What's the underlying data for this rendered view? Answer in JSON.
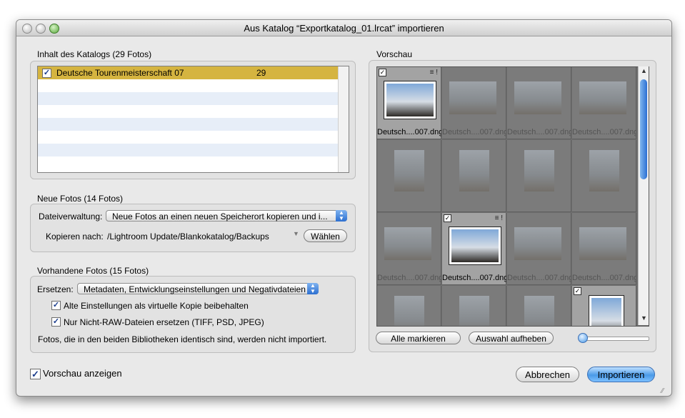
{
  "window": {
    "title": "Aus Katalog “Exportkatalog_01.lrcat” importieren"
  },
  "catalog": {
    "label": "Inhalt des Katalogs (29 Fotos)",
    "rows": [
      {
        "name": "Deutsche Tourenmeisterschaft 07",
        "count": "29",
        "checked": true
      }
    ]
  },
  "new_photos": {
    "label": "Neue Fotos (14 Fotos)",
    "file_handling_label": "Dateiverwaltung:",
    "file_handling_value": "Neue Fotos an einen neuen Speicherort kopieren und i...",
    "copy_to_label": "Kopieren nach:",
    "copy_to_path": "/Lightroom Update/Blankokatalog/Backups",
    "choose_button": "Wählen"
  },
  "existing_photos": {
    "label": "Vorhandene Fotos (15 Fotos)",
    "replace_label": "Ersetzen:",
    "replace_value": "Metadaten, Entwicklungseinstellungen und Negativdateien",
    "keep_old_label": "Alte Einstellungen als virtuelle Kopie beibehalten",
    "non_raw_label": "Nur Nicht-RAW-Dateien ersetzen (TIFF, PSD, JPEG)",
    "note": "Fotos, die in den beiden Bibliotheken identisch sind, werden nicht importiert."
  },
  "preview": {
    "label": "Vorschau",
    "filename": "Deutsch....007.dng",
    "cells": [
      {
        "active": true,
        "label": true
      },
      {
        "active": false,
        "label": true
      },
      {
        "active": false,
        "label": true
      },
      {
        "active": false,
        "label": true
      },
      {
        "active": false,
        "label": false
      },
      {
        "active": false,
        "label": false
      },
      {
        "active": false,
        "label": false
      },
      {
        "active": false,
        "label": false
      },
      {
        "active": false,
        "label": true
      },
      {
        "active": true,
        "label": true
      },
      {
        "active": false,
        "label": true
      },
      {
        "active": false,
        "label": true
      },
      {
        "active": false,
        "label": false
      },
      {
        "active": false,
        "label": false
      },
      {
        "active": false,
        "label": false
      },
      {
        "active": true,
        "label": false
      }
    ],
    "mark_all_button": "Alle markieren",
    "unmark_button": "Auswahl aufheben"
  },
  "footer": {
    "show_preview_label": "Vorschau anzeigen",
    "cancel_button": "Abbrechen",
    "import_button": "Importieren"
  },
  "icons": {
    "checkmark": "check-icon",
    "flag": "flag-icon",
    "popup_arrows": "updown-arrows-icon"
  }
}
